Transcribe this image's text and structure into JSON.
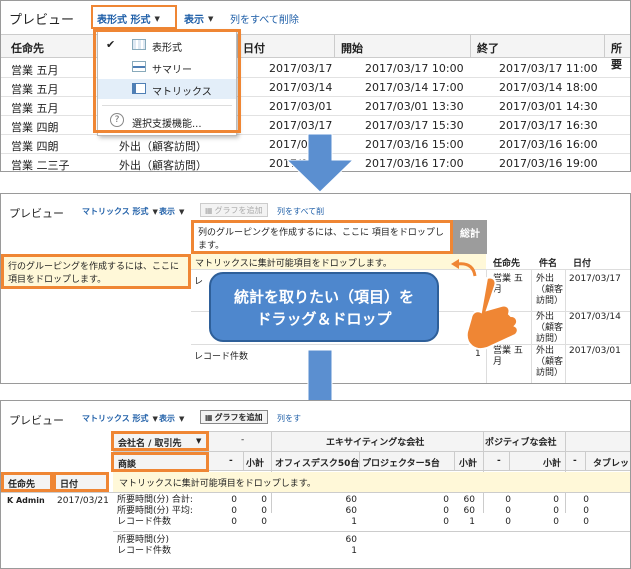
{
  "panel1": {
    "preview": "プレビュー",
    "format_btn": "表形式 形式",
    "display_btn": "表示",
    "remove_cols": "列をすべて削除",
    "headers": [
      "任命先",
      "日付",
      "開始",
      "終了",
      "所要"
    ],
    "rows": [
      {
        "owner": "営業 五月",
        "date": "2017/03/17",
        "start": "2017/03/17 10:00",
        "end": "2017/03/17 11:00"
      },
      {
        "owner": "営業 五月",
        "date": "2017/03/14",
        "start": "2017/03/14 17:00",
        "end": "2017/03/14 18:00"
      },
      {
        "owner": "営業 五月",
        "date": "2017/03/01",
        "start": "2017/03/01 13:30",
        "end": "2017/03/01 14:30"
      },
      {
        "owner": "営業 四朗",
        "date": "2017/03/17",
        "start": "2017/03/17 15:30",
        "end": "2017/03/17 16:30"
      },
      {
        "owner": "営業 四朗",
        "subject": "外出（顧客訪問）",
        "date": "2017/03/16",
        "start": "2017/03/16 15:00",
        "end": "2017/03/16 16:00"
      },
      {
        "owner": "営業 二三子",
        "subject": "外出（顧客訪問）",
        "date": "2017/03/16",
        "start": "2017/03/16 17:00",
        "end": "2017/03/16 19:00"
      }
    ],
    "menu": {
      "items": [
        {
          "label": "表形式",
          "checked": true,
          "icon": "tabular-format-icon"
        },
        {
          "label": "サマリー",
          "checked": false,
          "icon": "summary-format-icon"
        },
        {
          "label": "マトリックス",
          "checked": false,
          "icon": "matrix-format-icon"
        }
      ],
      "help": "選択支援機能..."
    }
  },
  "panel2": {
    "preview": "プレビュー",
    "format_btn": "マトリックス 形式",
    "display_btn": "表示",
    "add_chart": "グラフを追加",
    "remove_cols": "列をすべて削",
    "col_group_hint": "列のグルーピングを作成するには、ここに 項目をドロップします。",
    "total": "総計",
    "row_group_hint": "行のグルーピングを作成するには、ここに 項目をドロップします。",
    "summary_drop": "マトリックスに集計可能項目をドロップします。",
    "detail_headers": [
      "任命先",
      "件名",
      "日付"
    ],
    "detail_rows": [
      {
        "owner": "営業 五月",
        "subject": "外出（顧客訪問）",
        "date": "2017/03/17"
      },
      {
        "owner": "",
        "subject": "外出（顧客訪問）",
        "date": "2017/03/14"
      },
      {
        "owner": "営業 五月",
        "subject": "外出（顧客訪問）",
        "date": "2017/03/01"
      }
    ],
    "record_count": "レコード件数",
    "count_val": "1",
    "left_cut": "レ",
    "callout": "統計を取りたい（項目）を ドラッグ＆ドロップ"
  },
  "panel3": {
    "preview": "プレビュー",
    "format_btn": "マトリックス 形式",
    "display_btn": "表示",
    "add_chart": "グラフを追加",
    "remove_cols": "列をす",
    "col_field1": "会社名 / 取引先",
    "col_field2": "商談",
    "dash": "-",
    "group1": "エキサイティングな会社",
    "group2": "ポジティブな会社",
    "sub_headers": [
      "-",
      "小計",
      "オフィスデスク50台",
      "プロジェクター5台",
      "小計",
      "-",
      "小計",
      "-",
      "タブレッ"
    ],
    "row_field1": "任命先",
    "row_field2": "日付",
    "summary_drop": "マトリックスに集計可能項目をドロップします。",
    "row_owner": "K Admin",
    "row_date": "2017/03/21",
    "metrics": [
      "所要時間(分) 合計:",
      "所要時間(分) 平均:",
      "レコード件数"
    ],
    "values": {
      "c1": [
        "0",
        "0",
        "0"
      ],
      "c2": [
        "0",
        "0",
        "0"
      ],
      "c3": [
        "60",
        "60",
        "1"
      ],
      "c4": [
        "0",
        "0",
        "0"
      ],
      "c5": [
        "60",
        "60",
        "1"
      ],
      "c6": [
        "0",
        "0",
        "0"
      ],
      "c7": [
        "0",
        "0",
        "0"
      ],
      "c8": [
        "0",
        "0",
        "0"
      ]
    },
    "footer_metrics": [
      "所要時間(分)",
      "レコード件数"
    ],
    "footer_vals": [
      "60",
      "1"
    ]
  }
}
